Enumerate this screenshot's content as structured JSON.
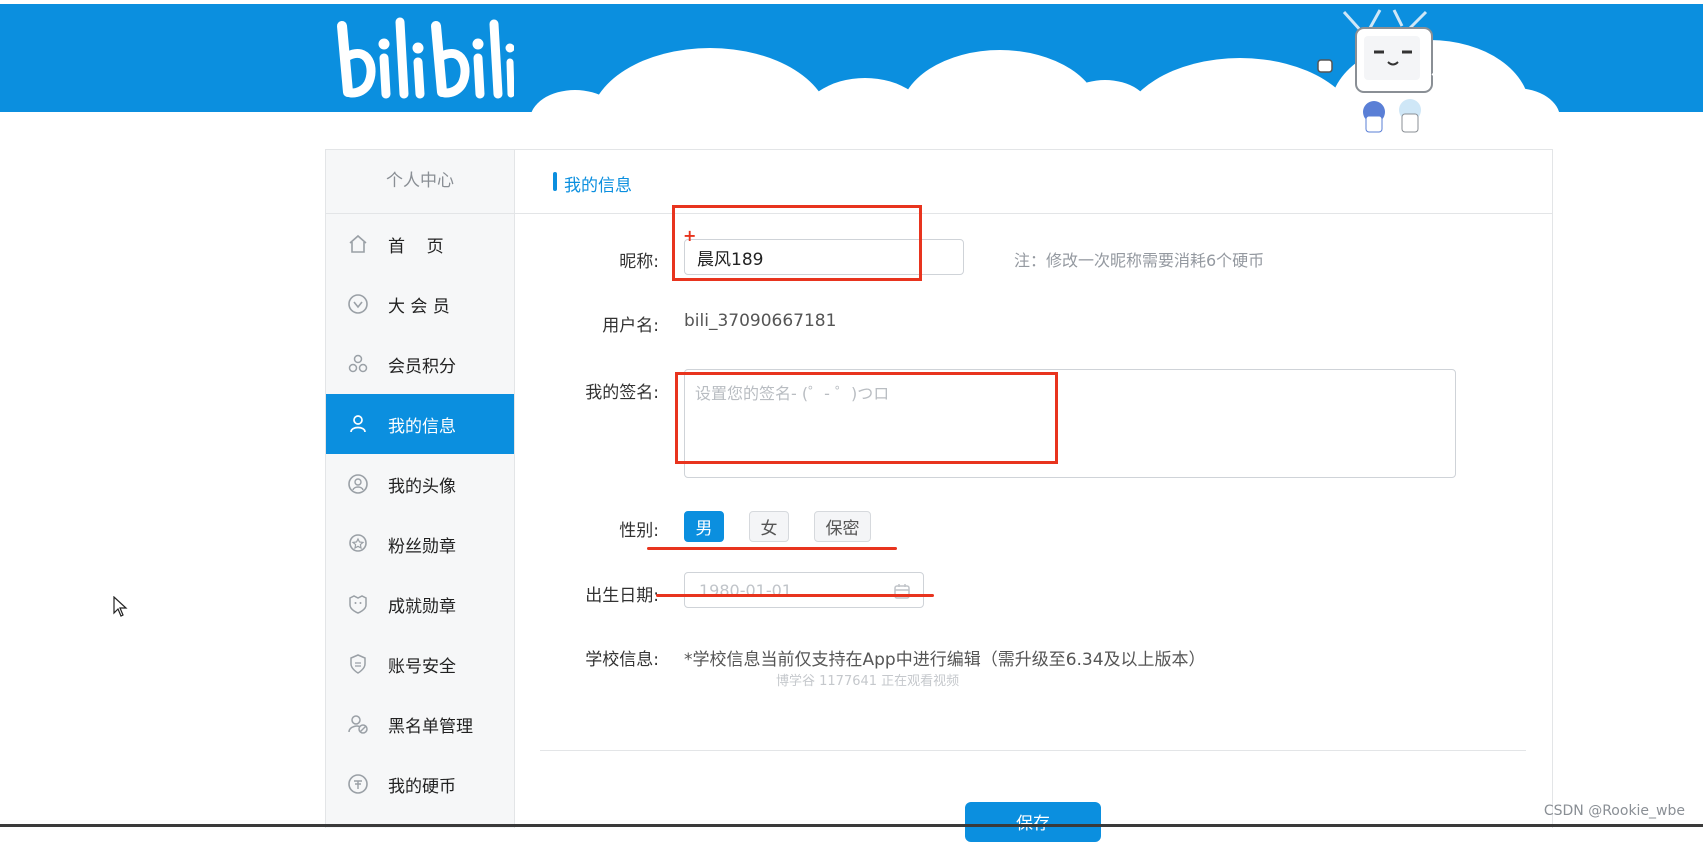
{
  "brand": {
    "logo_text": "bilibili",
    "accent": "#0b8fdf",
    "annotation_color": "#e8341e"
  },
  "sidebar": {
    "title": "个人中心",
    "items": [
      {
        "label": "首    页",
        "icon": "home-icon",
        "active": false
      },
      {
        "label": "大 会 员",
        "icon": "vip-icon",
        "active": false
      },
      {
        "label": "会员积分",
        "icon": "points-icon",
        "active": false
      },
      {
        "label": "我的信息",
        "icon": "user-icon",
        "active": true
      },
      {
        "label": "我的头像",
        "icon": "avatar-icon",
        "active": false
      },
      {
        "label": "粉丝勋章",
        "icon": "fan-medal-icon",
        "active": false
      },
      {
        "label": "成就勋章",
        "icon": "achievement-icon",
        "active": false
      },
      {
        "label": "账号安全",
        "icon": "shield-icon",
        "active": false
      },
      {
        "label": "黑名单管理",
        "icon": "blacklist-icon",
        "active": false
      },
      {
        "label": "我的硬币",
        "icon": "coin-icon",
        "active": false
      }
    ]
  },
  "main": {
    "section_title": "我的信息",
    "nickname": {
      "label": "昵称:",
      "value": "晨风189",
      "note": "注：修改一次昵称需要消耗6个硬币"
    },
    "username": {
      "label": "用户名:",
      "value": "bili_37090667181"
    },
    "signature": {
      "label": "我的签名:",
      "placeholder": "设置您的签名- (゜- ゜)つロ"
    },
    "gender": {
      "label": "性别:",
      "options": [
        "男",
        "女",
        "保密"
      ],
      "selected": "男"
    },
    "birthday": {
      "label": "出生日期:",
      "placeholder": "1980-01-01"
    },
    "school": {
      "label": "学校信息:",
      "value": "*学校信息当前仅支持在App中进行编辑（需升级至6.34及以上版本）"
    },
    "viewer_overlay": "博学谷 1177641 正在观看视频",
    "save_label": "保存"
  },
  "watermark": "CSDN @Rookie_wbe"
}
